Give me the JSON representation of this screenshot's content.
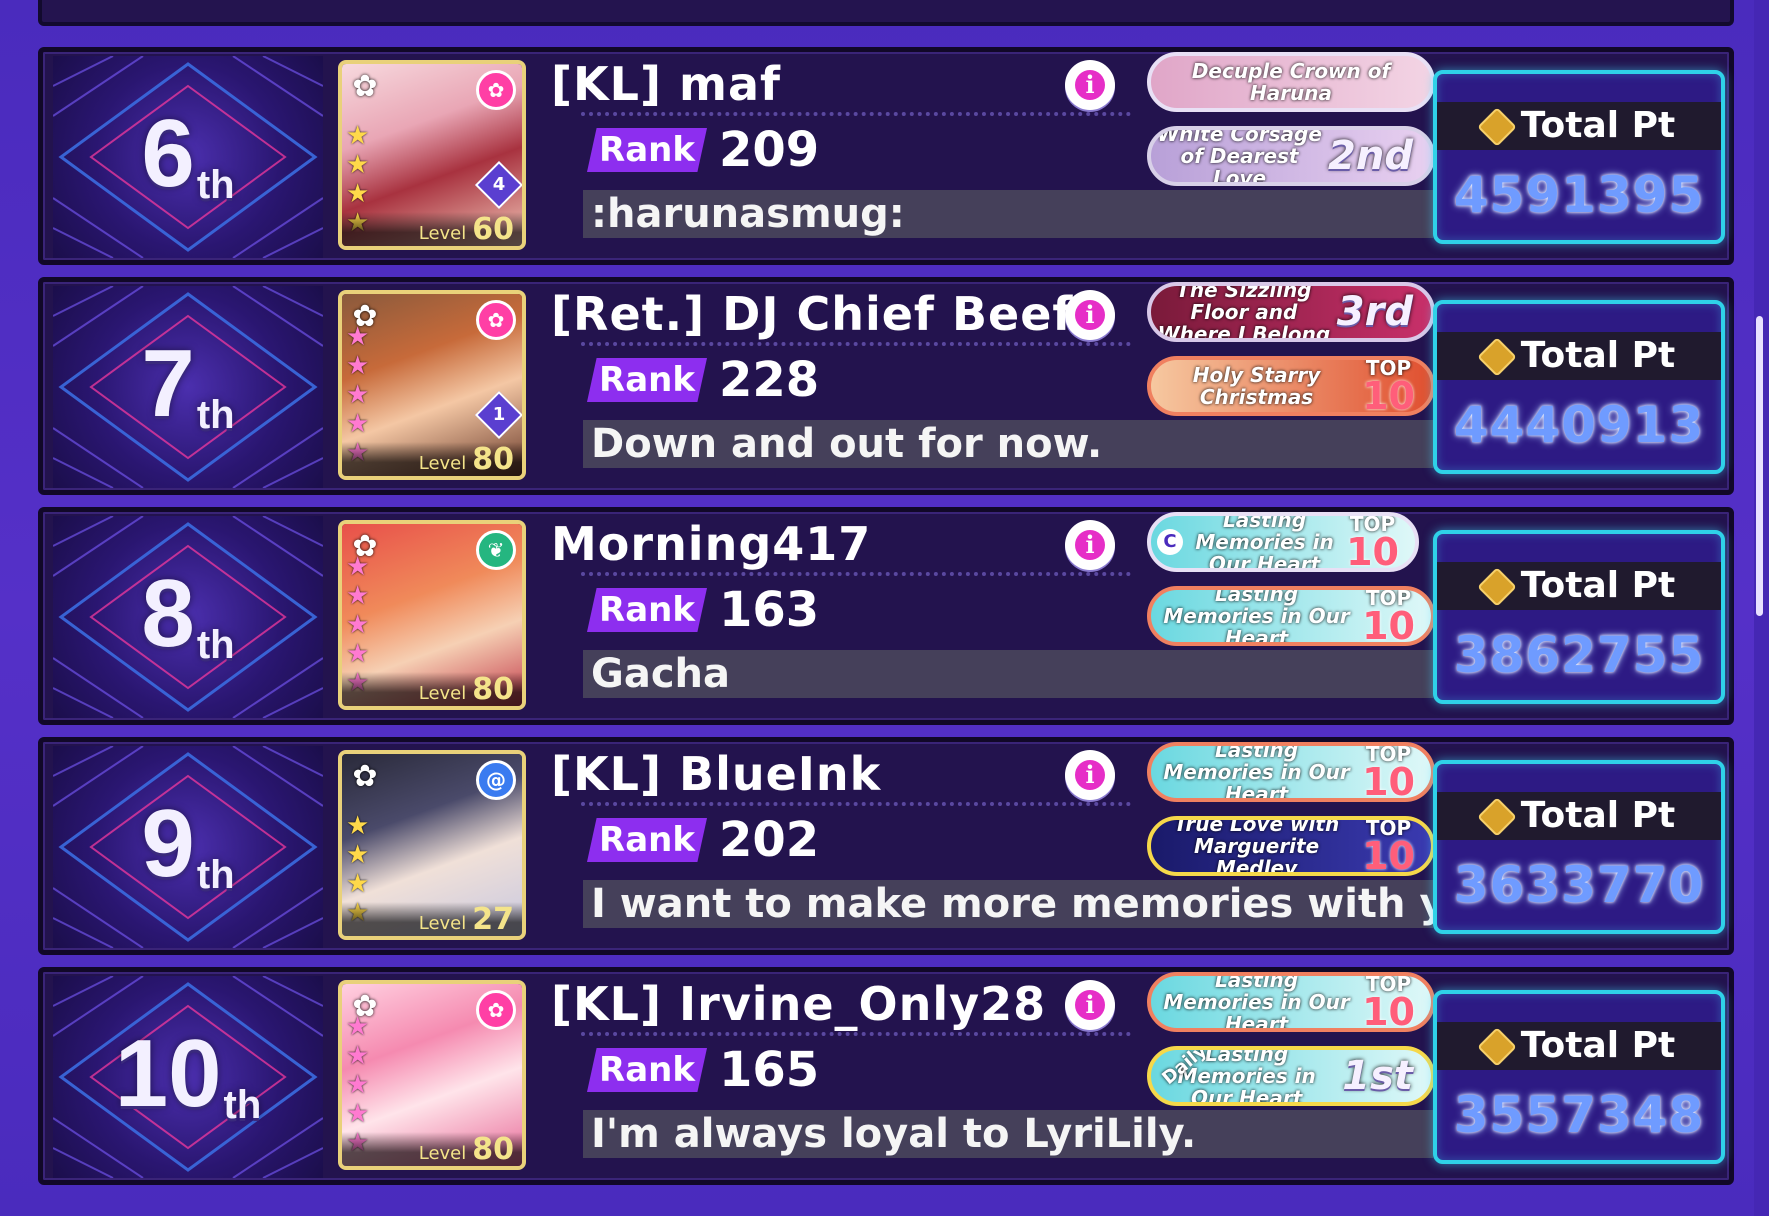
{
  "stat_label": "Total Pt",
  "rank_label": "Rank",
  "level_label": "Level",
  "colors": {
    "background": "#4a2bbd",
    "row_bg": "#23134e",
    "rank_tag": "#8d2eef",
    "total_pt_value": "#6f9bff",
    "total_pt_border": "#2fd2e8",
    "info_button": "#e62ec7"
  },
  "entries": [
    {
      "place": "6",
      "suffix": "th",
      "name": "[KL] maf",
      "rank": "209",
      "comment": ":harunasmug:",
      "level": "60",
      "master_rank": "4",
      "attribute_icon": "ribbon-icon",
      "band_icon": "band-logo-icon",
      "stars": 4,
      "badges": [
        {
          "title": "Decuple Crown of Haruna",
          "placement": ""
        },
        {
          "title": "White Corsage of Dearest Love",
          "placement": "2nd"
        }
      ],
      "total_pt": "4591395"
    },
    {
      "place": "7",
      "suffix": "th",
      "name": "[Ret.] DJ Chief Beef",
      "rank": "228",
      "comment": "Down and out for now.",
      "level": "80",
      "master_rank": "1",
      "attribute_icon": "ribbon-icon",
      "band_icon": "band-logo-icon",
      "stars": 5,
      "badges": [
        {
          "title": "The Sizzling Floor and Where I Belong",
          "placement": "3rd"
        },
        {
          "title": "Holy Starry Christmas",
          "top_label": "TOP",
          "top_value": "10"
        }
      ],
      "total_pt": "4440913"
    },
    {
      "place": "8",
      "suffix": "th",
      "name": "Morning417",
      "rank": "163",
      "comment": "Gacha",
      "level": "80",
      "master_rank": "",
      "attribute_icon": "leaf-icon",
      "band_icon": "band-logo-icon",
      "stars": 5,
      "badges": [
        {
          "title": "Lasting Memories in Our Heart",
          "top_label": "TOP",
          "top_value": "10",
          "mark": "C"
        },
        {
          "title": "Lasting Memories in Our Heart",
          "top_label": "TOP",
          "top_value": "10"
        }
      ],
      "total_pt": "3862755"
    },
    {
      "place": "9",
      "suffix": "th",
      "name": "[KL] BlueInk",
      "rank": "202",
      "comment": "I want to make more memories with you",
      "level": "27",
      "master_rank": "",
      "attribute_icon": "swirl-icon",
      "band_icon": "band-logo-icon",
      "stars": 4,
      "badges": [
        {
          "title": "Lasting Memories in Our Heart",
          "top_label": "TOP",
          "top_value": "10"
        },
        {
          "title": "True Love with Marguerite Medley",
          "top_label": "TOP",
          "top_value": "10"
        }
      ],
      "total_pt": "3633770"
    },
    {
      "place": "10",
      "suffix": "th",
      "name": "[KL] Irvine_Only28",
      "rank": "165",
      "comment": "I'm always loyal to LyriLily.",
      "level": "80",
      "master_rank": "",
      "attribute_icon": "ribbon-icon",
      "band_icon": "band-logo-icon",
      "stars": 5,
      "badges": [
        {
          "title": "Lasting Memories in Our Heart",
          "top_label": "TOP",
          "top_value": "10"
        },
        {
          "title": "Lasting Memories in Our Heart",
          "placement": "1st",
          "daily": "Daily"
        }
      ],
      "total_pt": "3557348"
    }
  ]
}
